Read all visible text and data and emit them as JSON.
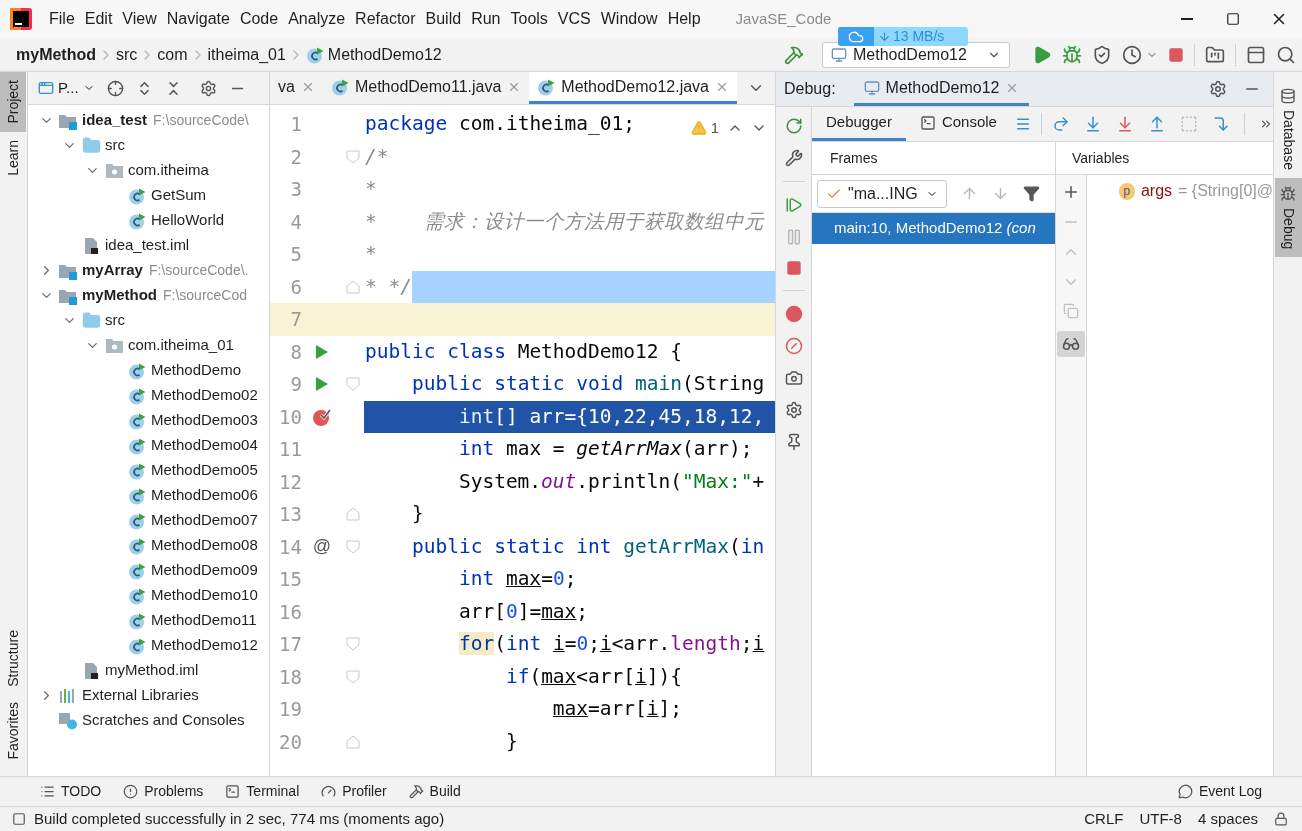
{
  "window": {
    "title": "JavaSE_Code"
  },
  "menu": [
    {
      "label": "File"
    },
    {
      "label": "Edit"
    },
    {
      "label": "View"
    },
    {
      "label": "Navigate"
    },
    {
      "label": "Code"
    },
    {
      "label": "Analyze"
    },
    {
      "label": "Refactor"
    },
    {
      "label": "Build"
    },
    {
      "label": "Run"
    },
    {
      "label": "Tools"
    },
    {
      "label": "VCS"
    },
    {
      "label": "Window"
    },
    {
      "label": "Help"
    }
  ],
  "breadcrumb": [
    {
      "label": "myMethod",
      "kind": "module"
    },
    {
      "label": "src",
      "kind": "dir"
    },
    {
      "label": "com",
      "kind": "dir"
    },
    {
      "label": "itheima_01",
      "kind": "dir"
    },
    {
      "label": "MethodDemo12",
      "kind": "class"
    }
  ],
  "run_config": {
    "label": "MethodDemo12"
  },
  "speed_widget": {
    "reading": "13 MB/s"
  },
  "left_stripe": {
    "top": [
      {
        "label": "Project",
        "selected": true
      },
      {
        "label": "Learn",
        "selected": false
      }
    ],
    "bottom": [
      {
        "label": "Structure",
        "selected": false
      },
      {
        "label": "Favorites",
        "selected": false
      }
    ]
  },
  "right_stripe": [
    {
      "label": "Database",
      "selected": false
    },
    {
      "label": "Debug",
      "selected": true
    }
  ],
  "project_panel": {
    "title": "P...",
    "tree": [
      {
        "label": "idea_test",
        "hint": "F:\\sourceCode\\",
        "kind": "module",
        "expanded": true,
        "children": [
          {
            "label": "src",
            "kind": "folder",
            "expanded": true,
            "children": [
              {
                "label": "com.itheima",
                "kind": "package",
                "expanded": true,
                "children": [
                  {
                    "label": "GetSum",
                    "kind": "class"
                  },
                  {
                    "label": "HelloWorld",
                    "kind": "class"
                  }
                ]
              }
            ]
          },
          {
            "label": "idea_test.iml",
            "kind": "file"
          }
        ]
      },
      {
        "label": "myArray",
        "hint": "F:\\sourceCode\\.",
        "kind": "module",
        "expanded": false
      },
      {
        "label": "myMethod",
        "hint": "F:\\sourceCod",
        "kind": "module",
        "expanded": true,
        "children": [
          {
            "label": "src",
            "kind": "folder",
            "expanded": true,
            "children": [
              {
                "label": "com.itheima_01",
                "kind": "package",
                "expanded": true,
                "children": [
                  {
                    "label": "MethodDemo",
                    "kind": "class"
                  },
                  {
                    "label": "MethodDemo02",
                    "kind": "class"
                  },
                  {
                    "label": "MethodDemo03",
                    "kind": "class"
                  },
                  {
                    "label": "MethodDemo04",
                    "kind": "class"
                  },
                  {
                    "label": "MethodDemo05",
                    "kind": "class"
                  },
                  {
                    "label": "MethodDemo06",
                    "kind": "class"
                  },
                  {
                    "label": "MethodDemo07",
                    "kind": "class"
                  },
                  {
                    "label": "MethodDemo08",
                    "kind": "class"
                  },
                  {
                    "label": "MethodDemo09",
                    "kind": "class"
                  },
                  {
                    "label": "MethodDemo10",
                    "kind": "class"
                  },
                  {
                    "label": "MethodDemo11",
                    "kind": "class"
                  },
                  {
                    "label": "MethodDemo12",
                    "kind": "class"
                  }
                ]
              }
            ]
          },
          {
            "label": "myMethod.iml",
            "kind": "file"
          }
        ]
      },
      {
        "label": "External Libraries",
        "kind": "library",
        "expanded": false
      },
      {
        "label": "Scratches and Consoles",
        "kind": "scratches"
      }
    ]
  },
  "editor": {
    "tabs": [
      {
        "label": "va",
        "selected": false
      },
      {
        "label": "MethodDemo11.java",
        "selected": false
      },
      {
        "label": "MethodDemo12.java",
        "selected": true
      }
    ],
    "inspection": {
      "count": "1"
    },
    "lines": [
      {
        "number": "1",
        "tokens": [
          {
            "text": "package",
            "kind": "kw"
          },
          {
            "text": " com.itheima_01;",
            "kind": "plain"
          }
        ]
      },
      {
        "number": "2",
        "fold": {
          "kind": "start"
        },
        "tokens": [
          {
            "text": "/*",
            "kind": "comment"
          }
        ]
      },
      {
        "number": "3",
        "tokens": [
          {
            "text": "*",
            "kind": "comment"
          }
        ]
      },
      {
        "number": "4",
        "tokens": [
          {
            "text": "*    需求：设计一个方法用于获取数组中元",
            "kind": "comment"
          }
        ]
      },
      {
        "number": "5",
        "tokens": [
          {
            "text": "*",
            "kind": "comment"
          }
        ]
      },
      {
        "number": "6",
        "fold": {
          "kind": "end"
        },
        "highlight": {
          "kind": "selection"
        },
        "tokens": [
          {
            "text": "* */",
            "kind": "comment"
          }
        ]
      },
      {
        "number": "7",
        "highlight": {
          "kind": "caret"
        }
      },
      {
        "number": "8",
        "marker": {
          "kind": "run"
        },
        "tokens": [
          {
            "text": "public class",
            "kind": "kw"
          },
          {
            "text": " MethodDemo12 {",
            "kind": "plain"
          }
        ]
      },
      {
        "number": "9",
        "marker": {
          "kind": "run"
        },
        "fold": {
          "kind": "start"
        },
        "tokens": [
          {
            "text": "    public static void ",
            "kind": "kw"
          },
          {
            "text": "main",
            "kind": "decl"
          },
          {
            "text": "(String",
            "kind": "plain"
          }
        ]
      },
      {
        "number": "10",
        "marker": {
          "kind": "breakpoint"
        },
        "highlight": {
          "kind": "execution"
        },
        "tokens": [
          {
            "text": "        int",
            "kind": "kw"
          },
          {
            "text": "[] arr={10,22,45,18,12,",
            "kind": "plain"
          }
        ]
      },
      {
        "number": "11",
        "tokens": [
          {
            "text": "        int",
            "kind": "kw"
          },
          {
            "text": " max = ",
            "kind": "plain"
          },
          {
            "text": "getArrMax",
            "kind": "call"
          },
          {
            "text": "(arr);",
            "kind": "plain"
          }
        ]
      },
      {
        "number": "12",
        "tokens": [
          {
            "text": "        System.",
            "kind": "plain"
          },
          {
            "text": "out",
            "kind": "field"
          },
          {
            "text": ".println(",
            "kind": "plain"
          },
          {
            "text": "\"Max:\"",
            "kind": "str"
          },
          {
            "text": "+",
            "kind": "plain"
          }
        ]
      },
      {
        "number": "13",
        "fold": {
          "kind": "end"
        },
        "tokens": [
          {
            "text": "    }",
            "kind": "plain"
          }
        ]
      },
      {
        "number": "14",
        "marker": {
          "kind": "override",
          "text": "@"
        },
        "fold": {
          "kind": "start"
        },
        "tokens": [
          {
            "text": "    public static int ",
            "kind": "kw"
          },
          {
            "text": "getArrMax",
            "kind": "decl"
          },
          {
            "text": "(",
            "kind": "plain"
          },
          {
            "text": "in",
            "kind": "kw"
          }
        ]
      },
      {
        "number": "15",
        "tokens": [
          {
            "text": "        int ",
            "kind": "kw"
          },
          {
            "text": "max",
            "kind": "var"
          },
          {
            "text": "=",
            "kind": "plain"
          },
          {
            "text": "0",
            "kind": "num"
          },
          {
            "text": ";",
            "kind": "plain"
          }
        ]
      },
      {
        "number": "16",
        "tokens": [
          {
            "text": "        arr[",
            "kind": "plain"
          },
          {
            "text": "0",
            "kind": "num"
          },
          {
            "text": "]=",
            "kind": "plain"
          },
          {
            "text": "max",
            "kind": "var"
          },
          {
            "text": ";",
            "kind": "plain"
          }
        ]
      },
      {
        "number": "17",
        "fold": {
          "kind": "start"
        },
        "tokens": [
          {
            "text": "        for",
            "kind": "kwmatch"
          },
          {
            "text": "(",
            "kind": "plain"
          },
          {
            "text": "int ",
            "kind": "kw"
          },
          {
            "text": "i",
            "kind": "var"
          },
          {
            "text": "=",
            "kind": "plain"
          },
          {
            "text": "0",
            "kind": "num"
          },
          {
            "text": ";",
            "kind": "plain"
          },
          {
            "text": "i",
            "kind": "var"
          },
          {
            "text": "<arr.",
            "kind": "plain"
          },
          {
            "text": "length",
            "kind": "member"
          },
          {
            "text": ";",
            "kind": "plain"
          },
          {
            "text": "i",
            "kind": "var"
          }
        ]
      },
      {
        "number": "18",
        "fold": {
          "kind": "start"
        },
        "tokens": [
          {
            "text": "            if",
            "kind": "kw"
          },
          {
            "text": "(",
            "kind": "plain"
          },
          {
            "text": "max",
            "kind": "var"
          },
          {
            "text": "<arr[",
            "kind": "plain"
          },
          {
            "text": "i",
            "kind": "var"
          },
          {
            "text": "]){",
            "kind": "plain"
          }
        ]
      },
      {
        "number": "19",
        "tokens": [
          {
            "text": "                max",
            "kind": "var"
          },
          {
            "text": "=arr[",
            "kind": "plain"
          },
          {
            "text": "i",
            "kind": "var"
          },
          {
            "text": "];",
            "kind": "plain"
          }
        ]
      },
      {
        "number": "20",
        "fold": {
          "kind": "end"
        },
        "tokens": [
          {
            "text": "            }",
            "kind": "plain"
          }
        ]
      }
    ]
  },
  "debug": {
    "title": "Debug:",
    "sessions": [
      {
        "label": "MethodDemo12",
        "selected": true
      }
    ],
    "tabs": [
      {
        "label": "Debugger",
        "selected": true
      },
      {
        "label": "Console",
        "selected": false
      }
    ],
    "frames": {
      "title": "Frames",
      "thread": "\"ma...ING",
      "items": [
        {
          "text": "main:10, MethodDemo12 *(con*",
          "selected": true
        }
      ]
    },
    "variables": {
      "title": "Variables",
      "items": [
        {
          "badge": "p",
          "name": "args",
          "value": "= {String[0]@"
        }
      ]
    }
  },
  "tool_windows": {
    "left": [
      {
        "label": "TODO",
        "kind": "todo"
      },
      {
        "label": "Problems",
        "kind": "problems"
      },
      {
        "label": "Terminal",
        "kind": "terminal"
      },
      {
        "label": "Profiler",
        "kind": "profiler"
      },
      {
        "label": "Build",
        "kind": "build"
      }
    ],
    "right": [
      {
        "label": "Event Log",
        "kind": "log"
      }
    ]
  },
  "status_bar": {
    "message": "Build completed successfully in 2 sec, 774 ms (moments ago)",
    "items": [
      "CRLF",
      "UTF-8",
      "4 spaces"
    ]
  }
}
